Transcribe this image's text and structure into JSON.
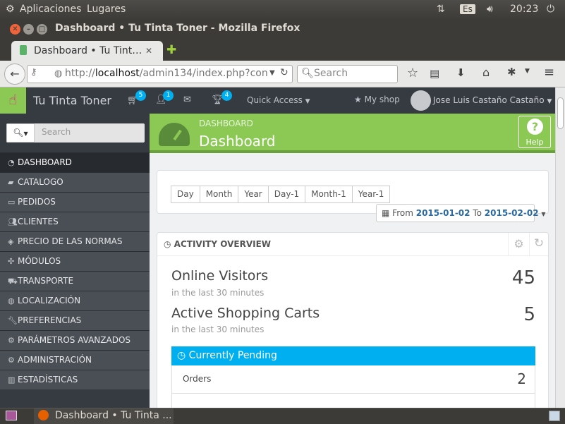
{
  "system_panel": {
    "menu_apps": "Aplicaciones",
    "menu_places": "Lugares",
    "keyboard": "Es",
    "time": "20:23"
  },
  "window": {
    "title": "Dashboard • Tu Tinta Toner - Mozilla Firefox"
  },
  "tab": {
    "label": "Dashboard • Tu Tint…",
    "close": "✕",
    "new_tab": "✚"
  },
  "navbar": {
    "url_prefix": "http://",
    "url_host": "localhost",
    "url_path": "/admin134/index.php?con",
    "search_placeholder": "Search"
  },
  "admin_header": {
    "shop_name": "Tu Tinta Toner",
    "badges": {
      "orders": "5",
      "customers": "1",
      "messages": "",
      "trophies": "4"
    },
    "quick_access": "Quick Access",
    "my_shop": "My shop",
    "user_name": "Jose Luis Castaño Castaño"
  },
  "sidebar": {
    "search_placeholder": "Search",
    "items": [
      {
        "label": "DASHBOARD",
        "icon": "dashboard-icon",
        "active": true
      },
      {
        "label": "CATALOGO",
        "icon": "book-icon"
      },
      {
        "label": "PEDIDOS",
        "icon": "credit-card-icon"
      },
      {
        "label": "CLIENTES",
        "icon": "users-icon"
      },
      {
        "label": "PRECIO DE LAS NORMAS",
        "icon": "tags-icon"
      },
      {
        "label": "MÓDULOS",
        "icon": "puzzle-icon"
      },
      {
        "label": "TRANSPORTE",
        "icon": "truck-icon"
      },
      {
        "label": "LOCALIZACIÓN",
        "icon": "globe-icon"
      },
      {
        "label": "PREFERENCIAS",
        "icon": "wrench-icon"
      },
      {
        "label": "PARÁMETROS AVANZADOS",
        "icon": "cogs-icon"
      },
      {
        "label": "ADMINISTRACIÓN",
        "icon": "cog-icon"
      },
      {
        "label": "ESTADÍSTICAS",
        "icon": "bar-chart-icon"
      }
    ]
  },
  "page_header": {
    "breadcrumb": "DASHBOARD",
    "title": "Dashboard",
    "help_label": "Help"
  },
  "date_filter": {
    "buttons": [
      "Day",
      "Month",
      "Year",
      "Day-1",
      "Month-1",
      "Year-1"
    ],
    "range_from_label": "From",
    "range_from": "2015-01-02",
    "range_to_label": "To",
    "range_to": "2015-02-02"
  },
  "activity": {
    "title": "ACTIVITY OVERVIEW",
    "stats": [
      {
        "label": "Online Visitors",
        "sub": "in the last 30 minutes",
        "value": "45"
      },
      {
        "label": "Active Shopping Carts",
        "sub": "in the last 30 minutes",
        "value": "5"
      }
    ],
    "pending_title": "Currently Pending",
    "pending_rows": [
      {
        "label": "Orders",
        "value": "2"
      }
    ]
  },
  "taskbar": {
    "window_label": "Dashboard • Tu Tinta ..."
  },
  "colors": {
    "accent_green": "#8bc954",
    "accent_blue": "#00aff0",
    "sidebar_bg": "#363a41",
    "firefox_orange": "#e66000"
  }
}
